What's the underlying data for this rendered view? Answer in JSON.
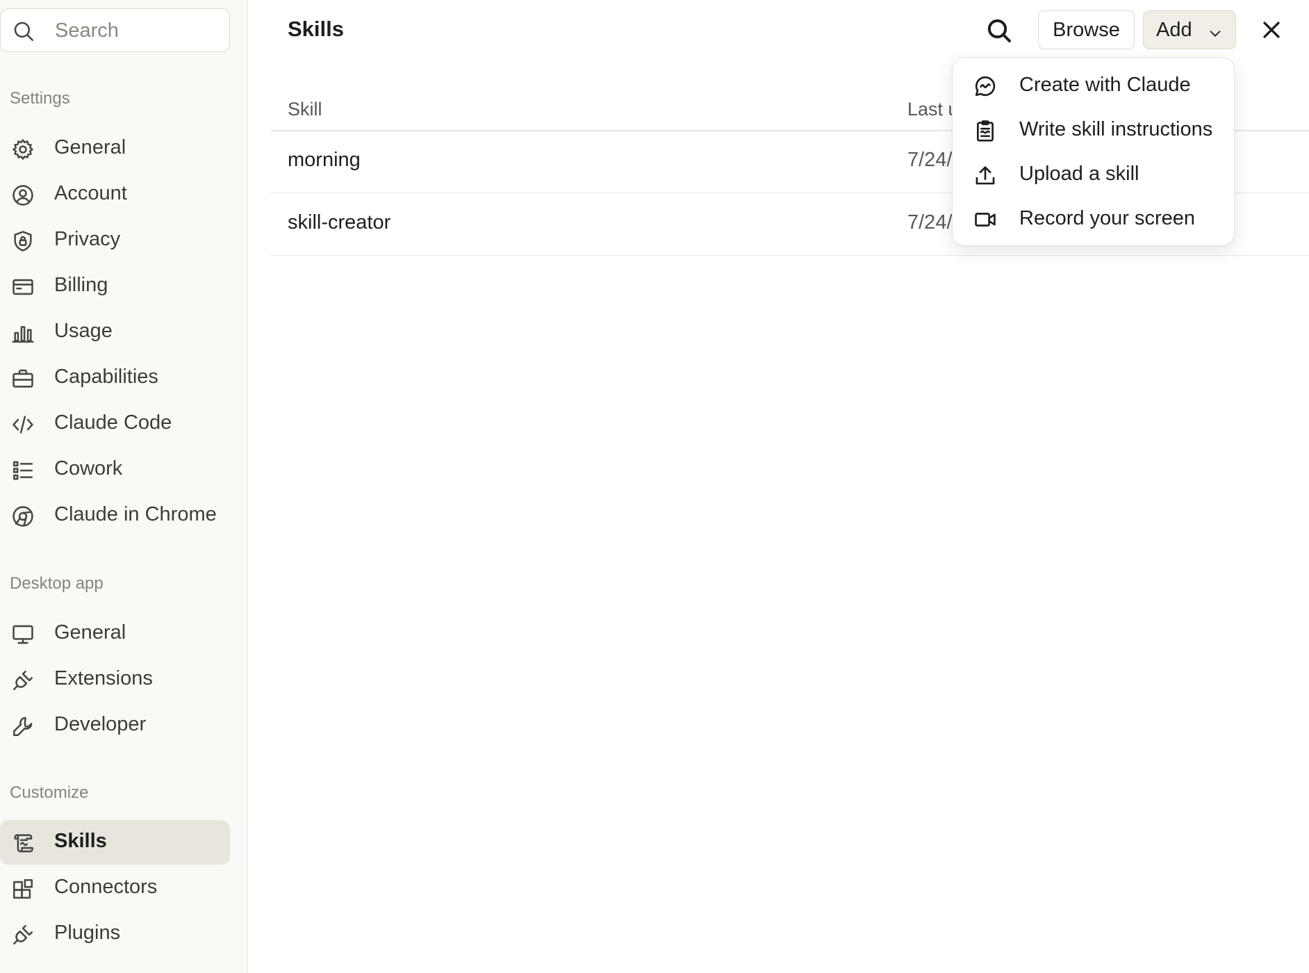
{
  "sidebar": {
    "search_placeholder": "Search",
    "sections": {
      "settings": "Settings",
      "desktop": "Desktop app",
      "customize": "Customize"
    },
    "settings_items": [
      {
        "label": "General",
        "icon": "gear-icon"
      },
      {
        "label": "Account",
        "icon": "user-circle-icon"
      },
      {
        "label": "Privacy",
        "icon": "shield-lock-icon"
      },
      {
        "label": "Billing",
        "icon": "credit-card-icon"
      },
      {
        "label": "Usage",
        "icon": "bar-chart-icon"
      },
      {
        "label": "Capabilities",
        "icon": "briefcase-icon"
      },
      {
        "label": "Claude Code",
        "icon": "code-icon"
      },
      {
        "label": "Cowork",
        "icon": "checklist-icon"
      },
      {
        "label": "Claude in Chrome",
        "icon": "globe-icon"
      }
    ],
    "desktop_items": [
      {
        "label": "General",
        "icon": "monitor-icon"
      },
      {
        "label": "Extensions",
        "icon": "plug-icon"
      },
      {
        "label": "Developer",
        "icon": "wrench-icon"
      }
    ],
    "customize_items": [
      {
        "label": "Skills",
        "icon": "scroll-icon",
        "active": true
      },
      {
        "label": "Connectors",
        "icon": "blocks-icon"
      },
      {
        "label": "Plugins",
        "icon": "plug-icon"
      }
    ]
  },
  "header": {
    "title": "Skills",
    "browse_label": "Browse",
    "add_label": "Add"
  },
  "table": {
    "columns": [
      "Skill",
      "Last u"
    ],
    "rows": [
      {
        "name": "morning",
        "date": "7/24/"
      },
      {
        "name": "skill-creator",
        "date": "7/24/"
      }
    ]
  },
  "add_menu": {
    "items": [
      {
        "label": "Create with Claude",
        "icon": "chat-bubble-icon"
      },
      {
        "label": "Write skill instructions",
        "icon": "clipboard-icon"
      },
      {
        "label": "Upload a skill",
        "icon": "upload-icon"
      },
      {
        "label": "Record your screen",
        "icon": "video-camera-icon"
      }
    ]
  }
}
